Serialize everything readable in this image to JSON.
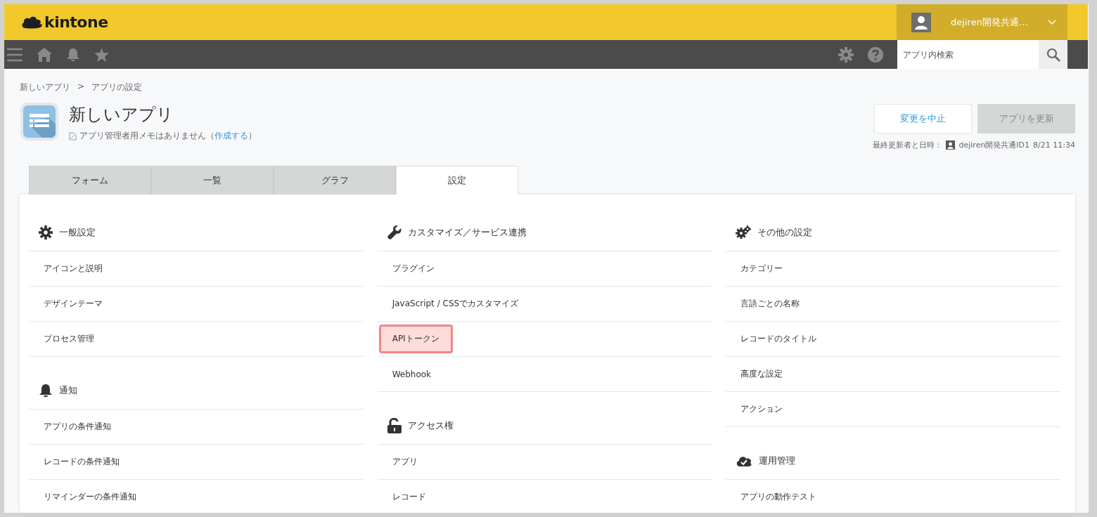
{
  "header": {
    "logo": "kintone",
    "user": {
      "name": "dejiren開発共通…"
    }
  },
  "toolbar": {
    "search": {
      "placeholder": "アプリ内検索"
    }
  },
  "breadcrumb": {
    "items": [
      "新しいアプリ",
      "アプリの設定"
    ],
    "separator": ">"
  },
  "app": {
    "title": "新しいアプリ",
    "memo": "アプリ管理者用メモはありません（",
    "memo_link": "作成する",
    "memo_end": "）"
  },
  "actions": [
    {
      "label": "変更を中止",
      "disabled": false
    },
    {
      "label": "アプリを更新",
      "disabled": true
    }
  ],
  "last_updated": {
    "label": "最終更新者と日時：",
    "user": "dejiren開発共通ID1",
    "time": "8/21 11:34"
  },
  "tabs": [
    {
      "label": "フォーム",
      "selected": false
    },
    {
      "label": "一覧",
      "selected": false
    },
    {
      "label": "グラフ",
      "selected": false
    },
    {
      "label": "設定",
      "selected": true
    }
  ],
  "columns": [
    [
      {
        "title": "一般設定",
        "items": [
          {
            "label": "アイコンと説明",
            "highlighted": false
          },
          {
            "label": "デザインテーマ",
            "highlighted": false
          },
          {
            "label": "プロセス管理",
            "highlighted": false
          }
        ]
      },
      {
        "title": "通知",
        "items": [
          {
            "label": "アプリの条件通知",
            "highlighted": false
          },
          {
            "label": "レコードの条件通知",
            "highlighted": false
          },
          {
            "label": "リマインダーの条件通知",
            "highlighted": false
          }
        ]
      }
    ],
    [
      {
        "title": "カスタマイズ／サービス連携",
        "items": [
          {
            "label": "プラグイン",
            "highlighted": false
          },
          {
            "label": "JavaScript / CSSでカスタマイズ",
            "highlighted": false
          },
          {
            "label": "APIトークン",
            "highlighted": true
          },
          {
            "label": "Webhook",
            "highlighted": false
          }
        ]
      },
      {
        "title": "アクセス権",
        "items": [
          {
            "label": "アプリ",
            "highlighted": false
          },
          {
            "label": "レコード",
            "highlighted": false
          }
        ]
      }
    ],
    [
      {
        "title": "その他の設定",
        "items": [
          {
            "label": "カテゴリー",
            "highlighted": false
          },
          {
            "label": "言語ごとの名称",
            "highlighted": false
          },
          {
            "label": "レコードのタイトル",
            "highlighted": false
          },
          {
            "label": "高度な設定",
            "highlighted": false
          },
          {
            "label": "アクション",
            "highlighted": false
          }
        ]
      },
      {
        "title": "運用管理",
        "items": [
          {
            "label": "アプリの動作テスト",
            "highlighted": false
          }
        ]
      }
    ]
  ]
}
